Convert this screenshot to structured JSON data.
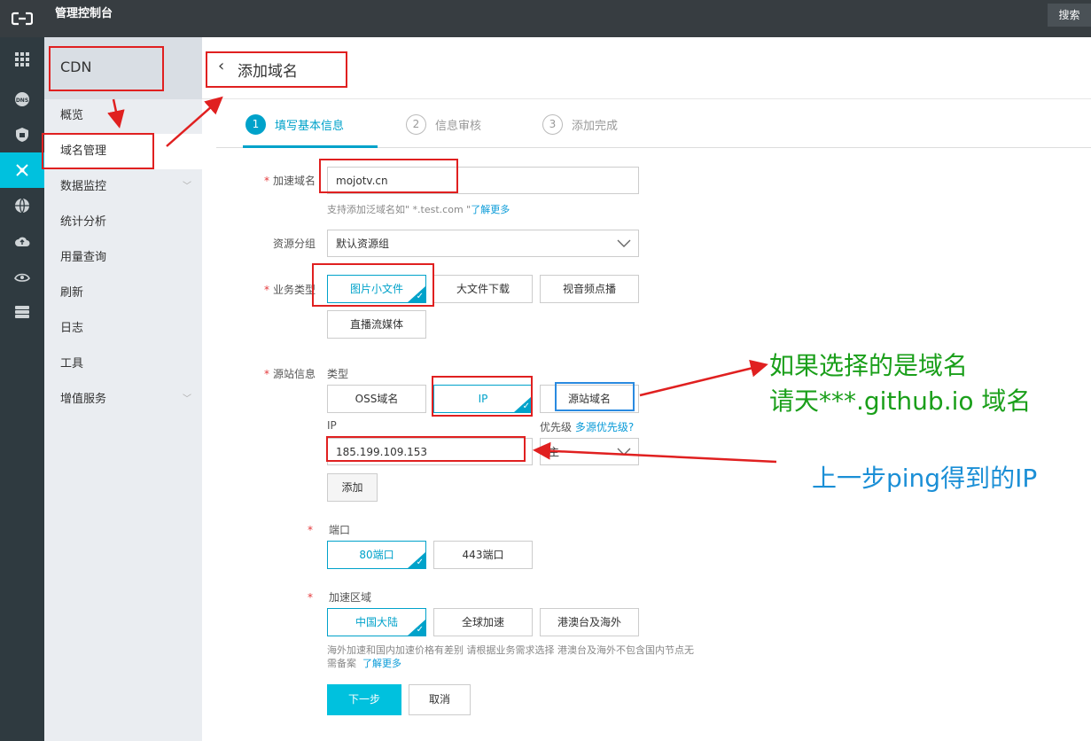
{
  "topbar": {
    "title": "管理控制台",
    "search": "搜索"
  },
  "sidebar": {
    "header": "CDN",
    "items": [
      {
        "label": "概览"
      },
      {
        "label": "域名管理"
      },
      {
        "label": "数据监控"
      },
      {
        "label": "统计分析"
      },
      {
        "label": "用量查询"
      },
      {
        "label": "刷新"
      },
      {
        "label": "日志"
      },
      {
        "label": "工具"
      },
      {
        "label": "增值服务"
      }
    ]
  },
  "page": {
    "title": "添加域名"
  },
  "steps": [
    {
      "num": "1",
      "label": "填写基本信息"
    },
    {
      "num": "2",
      "label": "信息审核"
    },
    {
      "num": "3",
      "label": "添加完成"
    }
  ],
  "form": {
    "domain_label": "加速域名",
    "domain_value": "mojotv.cn",
    "domain_hint_prefix": "支持添加泛域名如\" *.test.com \"",
    "domain_hint_link": "了解更多",
    "group_label": "资源分组",
    "group_value": "默认资源组",
    "biz_label": "业务类型",
    "biz_options": [
      "图片小文件",
      "大文件下载",
      "视音频点播",
      "直播流媒体"
    ],
    "origin_label": "源站信息",
    "origin_type_label": "类型",
    "origin_types": [
      "OSS域名",
      "IP",
      "源站域名"
    ],
    "ip_label": "IP",
    "ip_value": "185.199.109.153",
    "priority_label": "优先级",
    "priority_link": "多源优先级?",
    "priority_value": "主",
    "add_btn": "添加",
    "port_label": "端口",
    "ports": [
      "80端口",
      "443端口"
    ],
    "region_label": "加速区域",
    "regions": [
      "中国大陆",
      "全球加速",
      "港澳台及海外"
    ],
    "region_hint_line1": "海外加速和国内加速价格有差别 请根据业务需求选择 港澳台及海外不包含国内节点无",
    "region_hint_line2": "需备案",
    "region_hint_link": "了解更多",
    "next_btn": "下一步",
    "cancel_btn": "取消"
  },
  "annotations": {
    "green_line1": "如果选择的是域名",
    "green_line2": "请天***.github.io 域名",
    "blue": "上一步ping得到的IP"
  }
}
